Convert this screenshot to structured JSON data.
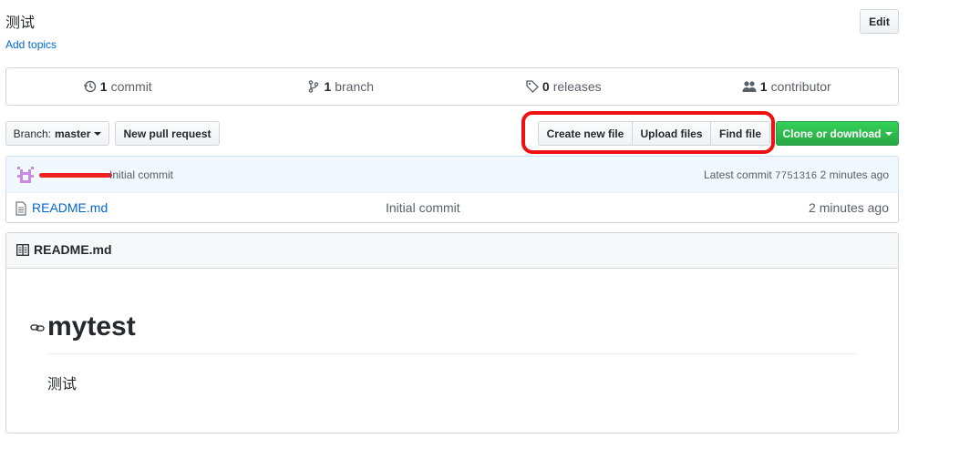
{
  "repo": {
    "description": "测试",
    "add_topics": "Add topics",
    "edit_label": "Edit"
  },
  "summary": [
    {
      "icon": "history-icon",
      "count": "1",
      "label": "commit"
    },
    {
      "icon": "branch-icon",
      "count": "1",
      "label": "branch"
    },
    {
      "icon": "tag-icon",
      "count": "0",
      "label": "releases"
    },
    {
      "icon": "people-icon",
      "count": "1",
      "label": "contributor"
    }
  ],
  "toolbar": {
    "branch_prefix": "Branch:",
    "branch_name": "master",
    "new_pull_request": "New pull request",
    "create_new_file": "Create new file",
    "upload_files": "Upload files",
    "find_file": "Find file",
    "clone_or_download": "Clone or download"
  },
  "latest_commit": {
    "message": "Initial commit",
    "prefix": "Latest commit",
    "sha": "7751316",
    "age": "2 minutes ago"
  },
  "files": [
    {
      "name": "README.md",
      "commit": "Initial commit",
      "age": "2 minutes ago"
    }
  ],
  "readme": {
    "header": "README.md",
    "heading": "mytest",
    "body": "测试"
  },
  "colors": {
    "accent": "#0366d6",
    "clone_green": "#28a745",
    "annotation_red": "#ee1111",
    "commit_bar_bg": "#f1f8ff"
  }
}
